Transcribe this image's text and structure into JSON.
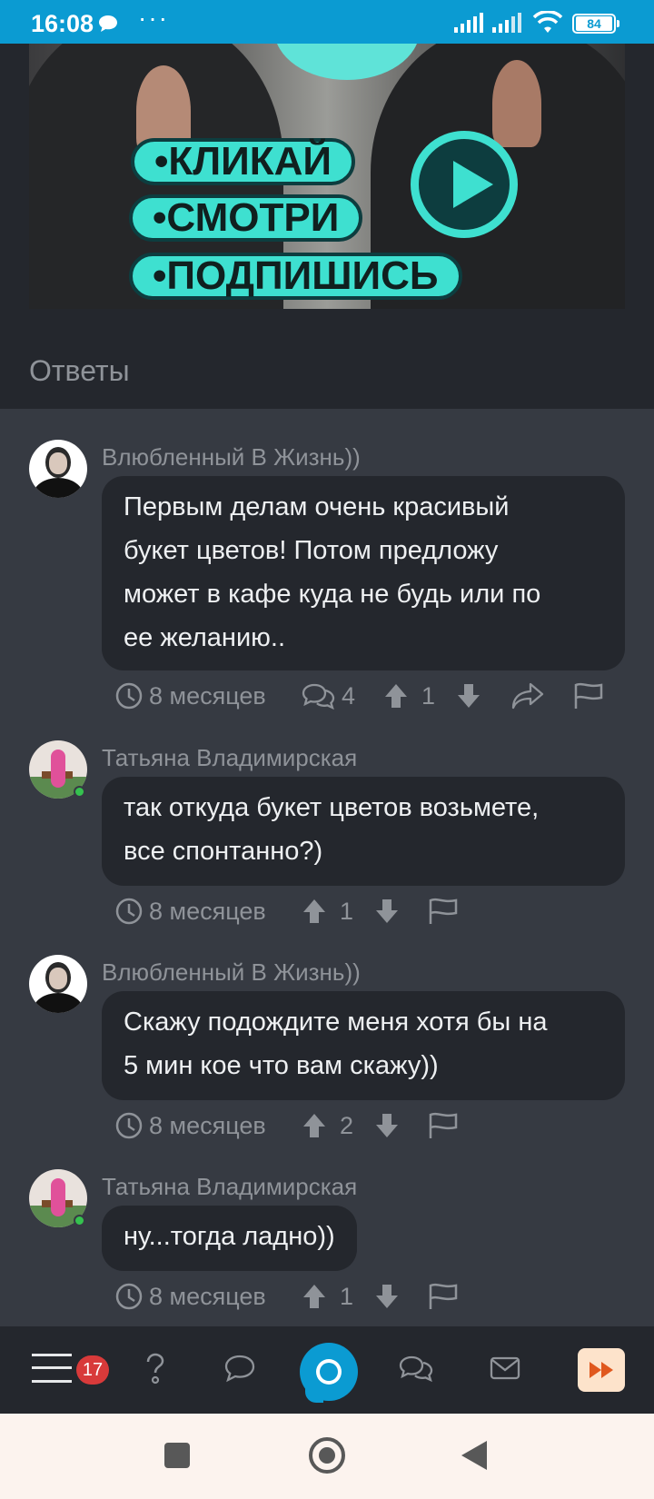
{
  "status_bar": {
    "time": "16:08",
    "more": "···",
    "battery": "84",
    "icons": [
      "message-bubble-icon",
      "signal-icon",
      "signal-icon",
      "wifi-icon",
      "battery-icon"
    ]
  },
  "banner": {
    "line1": "•КЛИКАЙ",
    "line2": "•СМОТРИ",
    "line3": "•ПОДПИШИСЬ",
    "accent": "#3ee0d0"
  },
  "section": {
    "title": "Ответы"
  },
  "comments": [
    {
      "author": "Влюбленный В Жизнь))",
      "text_lines": [
        "Первым делам очень красивый",
        "букет цветов! Потом предложу",
        "может в кафе куда не будь или по",
        "ее желанию.."
      ],
      "time": "8 месяцев",
      "replies": "4",
      "votes": "1"
    },
    {
      "author": "Татьяна Владимирская",
      "text_lines": [
        "так откуда букет цветов возьмете,",
        "все спонтанно?)"
      ],
      "time": "8 месяцев",
      "votes": "1"
    },
    {
      "author": "Влюбленный В Жизнь))",
      "text_lines": [
        "Скажу подождите меня хотя бы на",
        "5 мин кое что вам скажу))"
      ],
      "time": "8 месяцев",
      "votes": "2"
    },
    {
      "author": "Татьяна Владимирская",
      "text_lines": [
        "ну...тогда ладно))"
      ],
      "time": "8 месяцев",
      "votes": "1"
    }
  ],
  "bottom_nav": {
    "badge": "17",
    "items": [
      "menu-icon",
      "question-icon",
      "chat-icon",
      "home-logo",
      "discussions-icon",
      "mail-icon",
      "fast-forward-icon"
    ]
  },
  "colors": {
    "status_bar": "#0b9bd2",
    "background": "#363a42",
    "bubble": "#24272d",
    "online": "#35c24f",
    "badge": "#d83a3a"
  }
}
